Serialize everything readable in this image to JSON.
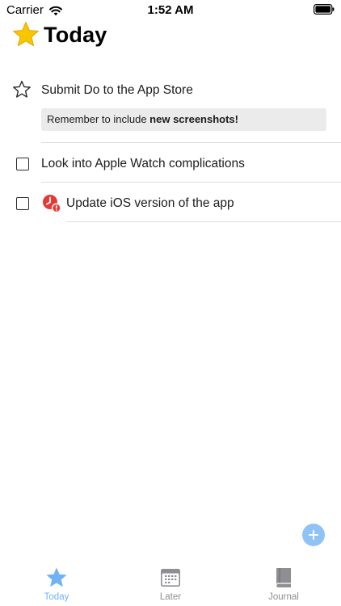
{
  "status_bar": {
    "carrier": "Carrier",
    "time": "1:52 AM"
  },
  "header": {
    "title": "Today",
    "title_icon": "star-icon",
    "title_icon_color": "#F7C600"
  },
  "tasks": [
    {
      "title": "Submit Do to the App Store",
      "icon": "star-outline-icon",
      "note": {
        "prefix": "Remember to include ",
        "bold": "new screenshots!"
      }
    },
    {
      "title": "Look into Apple Watch complications",
      "icon": "checkbox-icon"
    },
    {
      "title": "Update iOS version of the app",
      "icon": "checkbox-icon",
      "badge": "overdue-clock-icon",
      "badge_color": "#E53935"
    }
  ],
  "fab": {
    "icon": "plus-icon",
    "color": "#8FC3F5"
  },
  "tab_bar": {
    "active_color": "#6FB3F5",
    "inactive_color": "#8E8E93",
    "tabs": [
      {
        "label": "Today",
        "icon": "star-icon",
        "active": true
      },
      {
        "label": "Later",
        "icon": "calendar-icon",
        "active": false
      },
      {
        "label": "Journal",
        "icon": "book-icon",
        "active": false
      }
    ]
  }
}
